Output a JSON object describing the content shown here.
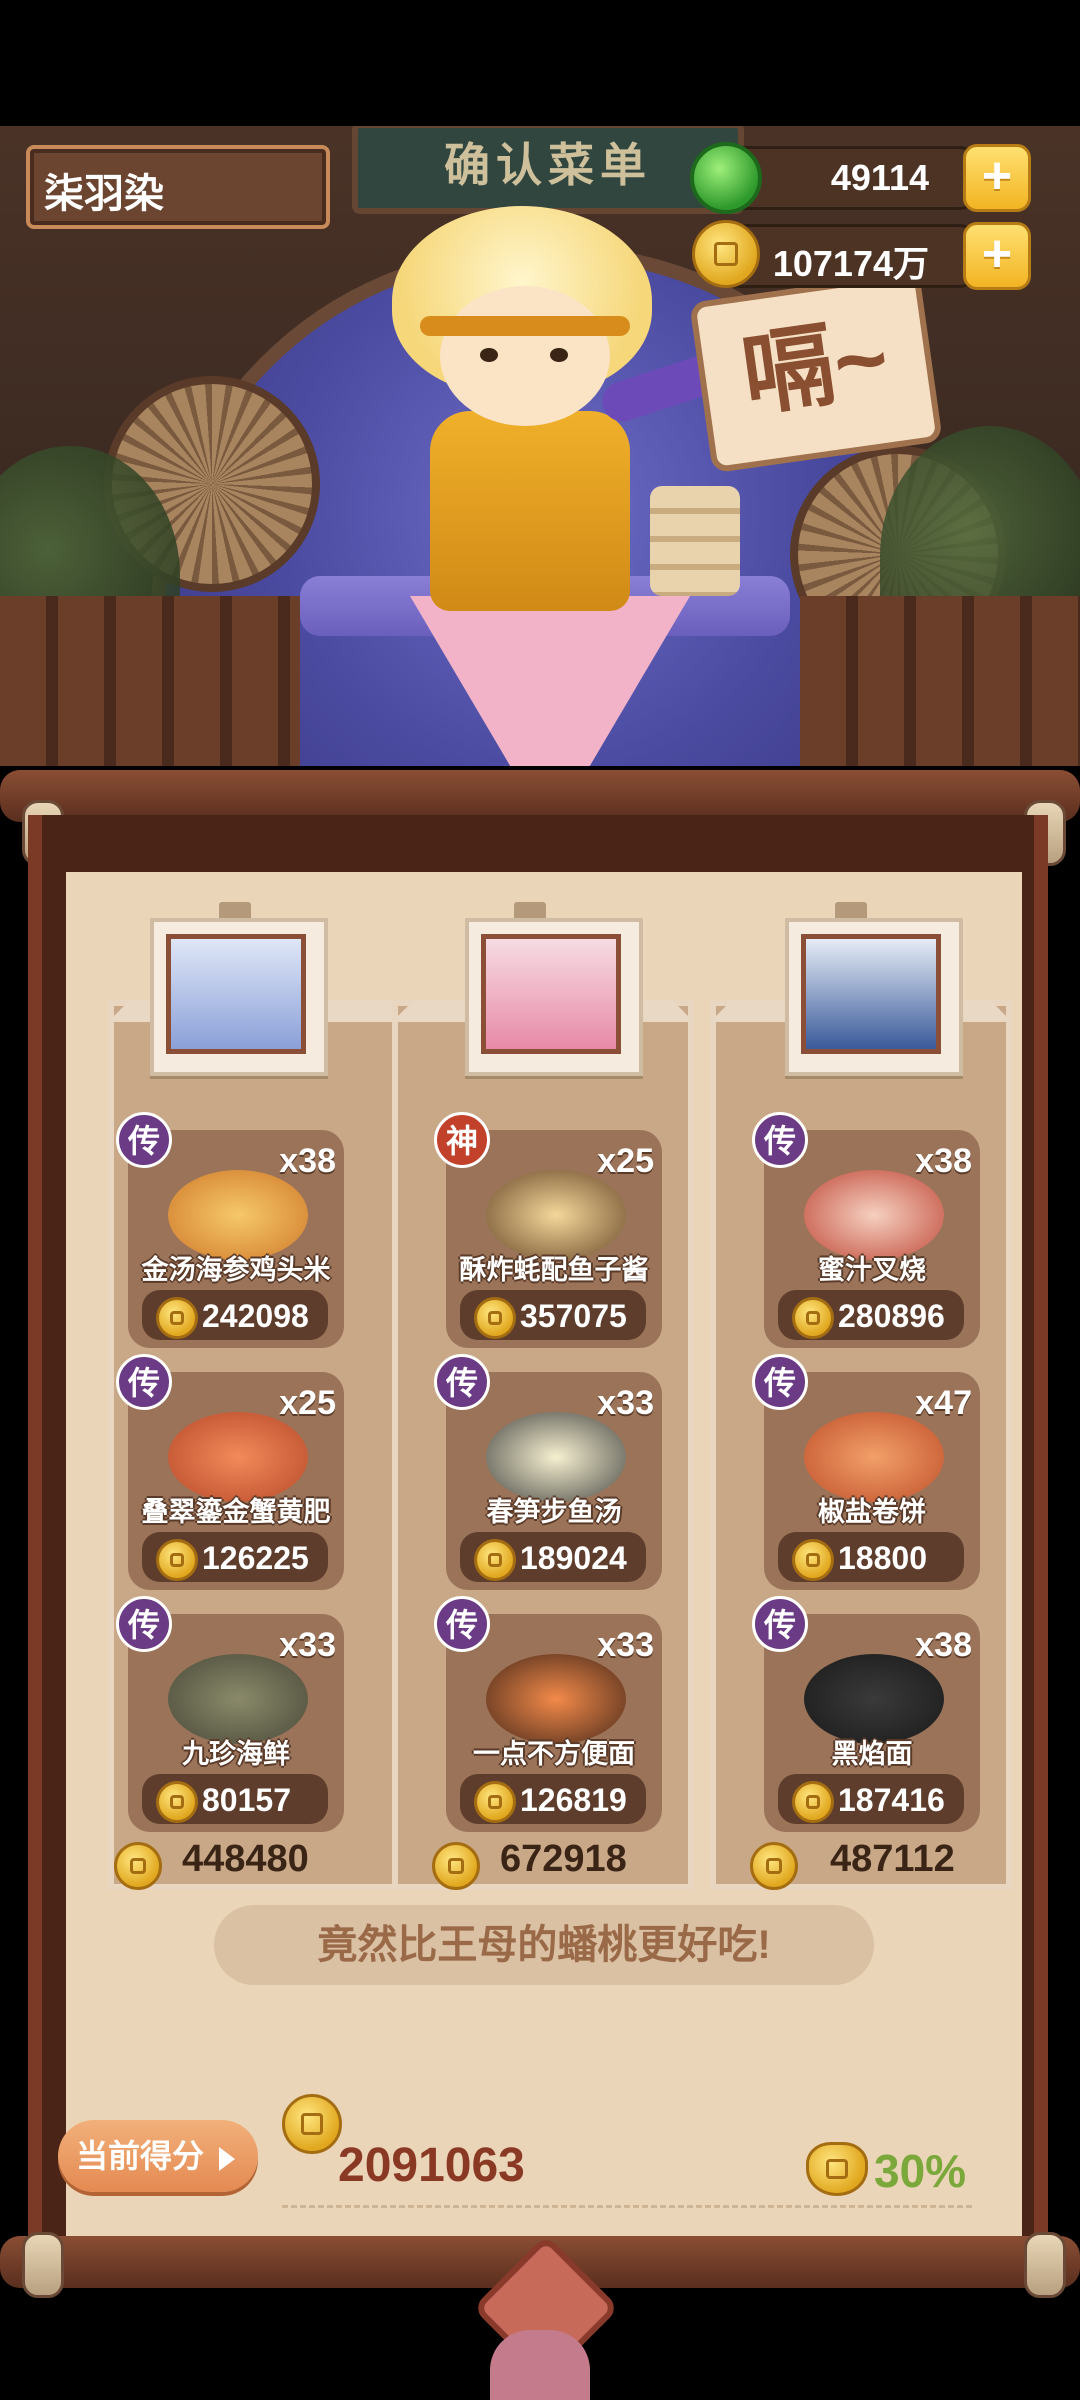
{
  "player": {
    "name": "柒羽染"
  },
  "currency": {
    "jade": "49114",
    "coins": "107174万",
    "plus": "+"
  },
  "scene": {
    "sign": "确认菜单",
    "speech": "嗝~"
  },
  "columns": [
    {
      "dishes": [
        {
          "badge": "传",
          "count": "x38",
          "name": "金汤海参鸡头米",
          "price": "242098"
        },
        {
          "badge": "传",
          "count": "x25",
          "name": "叠翠鎏金蟹黄肥",
          "price": "126225"
        },
        {
          "badge": "传",
          "count": "x33",
          "name": "九珍海鲜",
          "price": "80157"
        }
      ],
      "total": "448480"
    },
    {
      "dishes": [
        {
          "badge": "神",
          "count": "x25",
          "name": "酥炸蚝配鱼子酱",
          "price": "357075"
        },
        {
          "badge": "传",
          "count": "x33",
          "name": "春笋步鱼汤",
          "price": "189024"
        },
        {
          "badge": "传",
          "count": "x33",
          "name": "一点不方便面",
          "price": "126819"
        }
      ],
      "total": "672918"
    },
    {
      "dishes": [
        {
          "badge": "传",
          "count": "x38",
          "name": "蜜汁叉烧",
          "price": "280896"
        },
        {
          "badge": "传",
          "count": "x47",
          "name": "椒盐卷饼",
          "price": "18800"
        },
        {
          "badge": "传",
          "count": "x38",
          "name": "黑焰面",
          "price": "187416"
        }
      ],
      "total": "487112"
    }
  ],
  "comment": "竟然比王母的蟠桃更好吃!",
  "score": {
    "label": "当前得分",
    "value": "2091063",
    "percent": "30%"
  },
  "colors": {
    "badge_chuan": "#6b3b86",
    "badge_shen": "#c2412a",
    "paper": "#ead5b8",
    "wood": "#7a3a26",
    "percent": "#7aa83a"
  },
  "icons": [
    "jade-icon",
    "coin-icon",
    "plus-icon",
    "pouch-icon",
    "arrow-right-icon"
  ]
}
